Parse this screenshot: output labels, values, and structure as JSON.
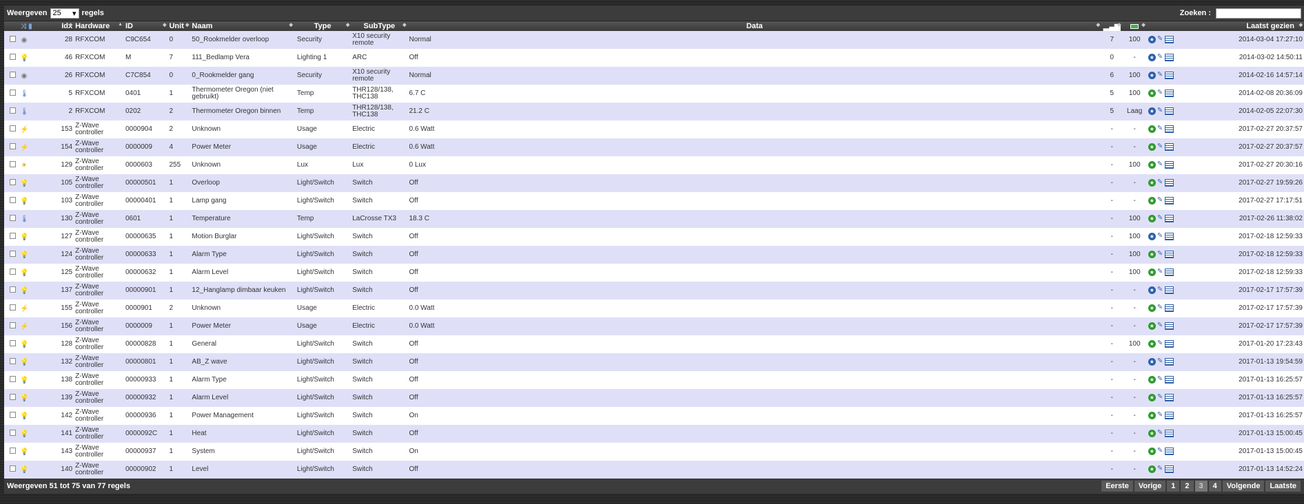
{
  "top": {
    "show_label": "Weergeven",
    "page_size": "25",
    "rows_label": "regels",
    "search_label": "Zoeken :",
    "search_value": ""
  },
  "columns": {
    "idx": "Idx",
    "hardware": "Hardware",
    "id": "ID",
    "unit": "Unit",
    "naam": "Naam",
    "type": "Type",
    "subtype": "SubType",
    "data": "Data",
    "last_seen": "Laatst gezien"
  },
  "rows": [
    {
      "icon": "smoke",
      "idx": "28",
      "hw": "RFXCOM",
      "id": "C9C654",
      "unit": "0",
      "naam": "50_Rookmelder overloop",
      "type": "Security",
      "sub": "X10 security remote",
      "data": "Normal",
      "sig": "7",
      "bat": "100",
      "act": "blue",
      "seen": "2014-03-04 17:27:10"
    },
    {
      "icon": "bulb",
      "idx": "46",
      "hw": "RFXCOM",
      "id": "M",
      "unit": "7",
      "naam": "111_Bedlamp Vera",
      "type": "Lighting 1",
      "sub": "ARC",
      "data": "Off",
      "sig": "0",
      "bat": "-",
      "act": "blue",
      "seen": "2014-03-02 14:50:11"
    },
    {
      "icon": "smoke",
      "idx": "26",
      "hw": "RFXCOM",
      "id": "C7C854",
      "unit": "0",
      "naam": "0_Rookmelder gang",
      "type": "Security",
      "sub": "X10 security remote",
      "data": "Normal",
      "sig": "6",
      "bat": "100",
      "act": "blue",
      "seen": "2014-02-16 14:57:14"
    },
    {
      "icon": "thermo",
      "idx": "5",
      "hw": "RFXCOM",
      "id": "0401",
      "unit": "1",
      "naam": "Thermometer Oregon (niet gebruikt)",
      "type": "Temp",
      "sub": "THR128/138, THC138",
      "data": "6.7 C",
      "sig": "5",
      "bat": "100",
      "act": "green",
      "seen": "2014-02-08 20:36:09"
    },
    {
      "icon": "thermo",
      "idx": "2",
      "hw": "RFXCOM",
      "id": "0202",
      "unit": "2",
      "naam": "Thermometer Oregon binnen",
      "type": "Temp",
      "sub": "THR128/138, THC138",
      "data": "21.2 C",
      "sig": "5",
      "bat": "Laag",
      "act": "blue",
      "seen": "2014-02-05 22:07:30"
    },
    {
      "icon": "plug",
      "idx": "153",
      "hw": "Z-Wave controller",
      "id": "0000904",
      "unit": "2",
      "naam": "Unknown",
      "type": "Usage",
      "sub": "Electric",
      "data": "0.6 Watt",
      "sig": "-",
      "bat": "-",
      "act": "green",
      "seen": "2017-02-27 20:37:57"
    },
    {
      "icon": "plug",
      "idx": "154",
      "hw": "Z-Wave controller",
      "id": "0000009",
      "unit": "4",
      "naam": "Power Meter",
      "type": "Usage",
      "sub": "Electric",
      "data": "0.6 Watt",
      "sig": "-",
      "bat": "-",
      "act": "green",
      "seen": "2017-02-27 20:37:57"
    },
    {
      "icon": "lux",
      "idx": "129",
      "hw": "Z-Wave controller",
      "id": "0000603",
      "unit": "255",
      "naam": "Unknown",
      "type": "Lux",
      "sub": "Lux",
      "data": "0 Lux",
      "sig": "-",
      "bat": "100",
      "act": "green",
      "seen": "2017-02-27 20:30:16"
    },
    {
      "icon": "bulb",
      "idx": "105",
      "hw": "Z-Wave controller",
      "id": "00000501",
      "unit": "1",
      "naam": "Overloop",
      "type": "Light/Switch",
      "sub": "Switch",
      "data": "Off",
      "sig": "-",
      "bat": "-",
      "act": "green",
      "seen": "2017-02-27 19:59:26"
    },
    {
      "icon": "bulb",
      "idx": "103",
      "hw": "Z-Wave controller",
      "id": "00000401",
      "unit": "1",
      "naam": "Lamp gang",
      "type": "Light/Switch",
      "sub": "Switch",
      "data": "Off",
      "sig": "-",
      "bat": "-",
      "act": "green",
      "seen": "2017-02-27 17:17:51"
    },
    {
      "icon": "thermo",
      "idx": "130",
      "hw": "Z-Wave controller",
      "id": "0601",
      "unit": "1",
      "naam": "Temperature",
      "type": "Temp",
      "sub": "LaCrosse TX3",
      "data": "18.3 C",
      "sig": "-",
      "bat": "100",
      "act": "green",
      "seen": "2017-02-26 11:38:02"
    },
    {
      "icon": "bulb",
      "idx": "127",
      "hw": "Z-Wave controller",
      "id": "00000635",
      "unit": "1",
      "naam": "Motion Burglar",
      "type": "Light/Switch",
      "sub": "Switch",
      "data": "Off",
      "sig": "-",
      "bat": "100",
      "act": "blue",
      "seen": "2017-02-18 12:59:33"
    },
    {
      "icon": "bulb",
      "idx": "124",
      "hw": "Z-Wave controller",
      "id": "00000633",
      "unit": "1",
      "naam": "Alarm Type",
      "type": "Light/Switch",
      "sub": "Switch",
      "data": "Off",
      "sig": "-",
      "bat": "100",
      "act": "green",
      "seen": "2017-02-18 12:59:33"
    },
    {
      "icon": "bulb",
      "idx": "125",
      "hw": "Z-Wave controller",
      "id": "00000632",
      "unit": "1",
      "naam": "Alarm Level",
      "type": "Light/Switch",
      "sub": "Switch",
      "data": "Off",
      "sig": "-",
      "bat": "100",
      "act": "green",
      "seen": "2017-02-18 12:59:33"
    },
    {
      "icon": "bulb",
      "idx": "137",
      "hw": "Z-Wave controller",
      "id": "00000901",
      "unit": "1",
      "naam": "12_Hanglamp dimbaar keuken",
      "type": "Light/Switch",
      "sub": "Switch",
      "data": "Off",
      "sig": "-",
      "bat": "-",
      "act": "blue",
      "seen": "2017-02-17 17:57:39"
    },
    {
      "icon": "plug",
      "idx": "155",
      "hw": "Z-Wave controller",
      "id": "0000901",
      "unit": "2",
      "naam": "Unknown",
      "type": "Usage",
      "sub": "Electric",
      "data": "0.0 Watt",
      "sig": "-",
      "bat": "-",
      "act": "green",
      "seen": "2017-02-17 17:57:39"
    },
    {
      "icon": "plug",
      "idx": "156",
      "hw": "Z-Wave controller",
      "id": "0000009",
      "unit": "1",
      "naam": "Power Meter",
      "type": "Usage",
      "sub": "Electric",
      "data": "0.0 Watt",
      "sig": "-",
      "bat": "-",
      "act": "green",
      "seen": "2017-02-17 17:57:39"
    },
    {
      "icon": "bulb",
      "idx": "128",
      "hw": "Z-Wave controller",
      "id": "00000828",
      "unit": "1",
      "naam": "General",
      "type": "Light/Switch",
      "sub": "Switch",
      "data": "Off",
      "sig": "-",
      "bat": "100",
      "act": "green",
      "seen": "2017-01-20 17:23:43"
    },
    {
      "icon": "bulb",
      "idx": "132",
      "hw": "Z-Wave controller",
      "id": "00000801",
      "unit": "1",
      "naam": "AB_Z wave",
      "type": "Light/Switch",
      "sub": "Switch",
      "data": "Off",
      "sig": "-",
      "bat": "-",
      "act": "blue",
      "seen": "2017-01-13 19:54:59"
    },
    {
      "icon": "bulb",
      "idx": "138",
      "hw": "Z-Wave controller",
      "id": "00000933",
      "unit": "1",
      "naam": "Alarm Type",
      "type": "Light/Switch",
      "sub": "Switch",
      "data": "Off",
      "sig": "-",
      "bat": "-",
      "act": "green",
      "seen": "2017-01-13 16:25:57"
    },
    {
      "icon": "bulb",
      "idx": "139",
      "hw": "Z-Wave controller",
      "id": "00000932",
      "unit": "1",
      "naam": "Alarm Level",
      "type": "Light/Switch",
      "sub": "Switch",
      "data": "Off",
      "sig": "-",
      "bat": "-",
      "act": "green",
      "seen": "2017-01-13 16:25:57"
    },
    {
      "icon": "bulb-on",
      "idx": "142",
      "hw": "Z-Wave controller",
      "id": "00000936",
      "unit": "1",
      "naam": "Power Management",
      "type": "Light/Switch",
      "sub": "Switch",
      "data": "On",
      "sig": "-",
      "bat": "-",
      "act": "green",
      "seen": "2017-01-13 16:25:57"
    },
    {
      "icon": "bulb",
      "idx": "141",
      "hw": "Z-Wave controller",
      "id": "0000092C",
      "unit": "1",
      "naam": "Heat",
      "type": "Light/Switch",
      "sub": "Switch",
      "data": "Off",
      "sig": "-",
      "bat": "-",
      "act": "green",
      "seen": "2017-01-13 15:00:45"
    },
    {
      "icon": "bulb-on",
      "idx": "143",
      "hw": "Z-Wave controller",
      "id": "00000937",
      "unit": "1",
      "naam": "System",
      "type": "Light/Switch",
      "sub": "Switch",
      "data": "On",
      "sig": "-",
      "bat": "-",
      "act": "green",
      "seen": "2017-01-13 15:00:45"
    },
    {
      "icon": "bulb",
      "idx": "140",
      "hw": "Z-Wave controller",
      "id": "00000902",
      "unit": "1",
      "naam": "Level",
      "type": "Light/Switch",
      "sub": "Switch",
      "data": "Off",
      "sig": "-",
      "bat": "-",
      "act": "green",
      "seen": "2017-01-13 14:52:24"
    }
  ],
  "footer": {
    "info": "Weergeven 51 tot 75 van 77 regels",
    "first": "Eerste",
    "prev": "Vorige",
    "p1": "1",
    "p2": "2",
    "p3": "3",
    "p4": "4",
    "next": "Volgende",
    "last": "Laatste"
  }
}
